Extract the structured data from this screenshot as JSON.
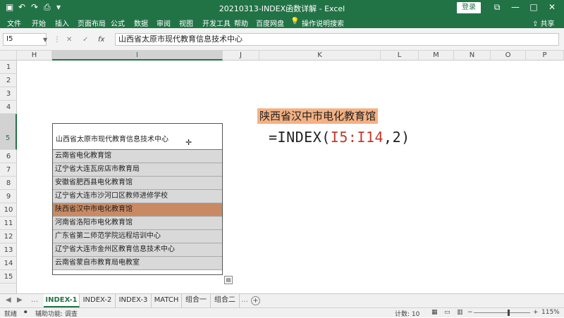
{
  "window": {
    "title": "20210313-INDEX函数详解 - Excel",
    "login_label": "登录",
    "restore_glyph": "⧉",
    "minimize_glyph": "—",
    "maximize_glyph": "□",
    "close_glyph": "✕"
  },
  "quick_access": {
    "autosave_glyph": "▣",
    "undo_glyph": "↶",
    "redo_glyph": "↷",
    "print_glyph": "⎙",
    "more_glyph": "▾"
  },
  "ribbon_tabs": [
    "文件",
    "开始",
    "插入",
    "页面布局",
    "公式",
    "数据",
    "审阅",
    "视图",
    "开发工具",
    "帮助",
    "百度网盘",
    "操作说明搜索"
  ],
  "share_label": "共享",
  "lightbulb_glyph": "💡",
  "formula_bar": {
    "name_box": "I5",
    "cancel_glyph": "✕",
    "enter_glyph": "✓",
    "fx_glyph": "fx",
    "content": "山西省太原市现代教育信息技术中心"
  },
  "columns": [
    "H",
    "I",
    "J",
    "K",
    "L",
    "M",
    "N",
    "O",
    "P"
  ],
  "selected_column": "I",
  "rows": [
    "1",
    "2",
    "3",
    "4",
    "5",
    "6",
    "7",
    "8",
    "9",
    "10",
    "11",
    "12",
    "13",
    "14",
    "15"
  ],
  "selected_row": "5",
  "table": {
    "header": "山西省太原市现代教育信息技术中心",
    "items": [
      "云南省电化教育馆",
      "辽宁省大连瓦房店市教育局",
      "安徽省肥西县电化教育馆",
      "辽宁省大连市沙河口区教师进修学校",
      "陕西省汉中市电化教育馆",
      "河南省洛阳市电化教育馆",
      "广东省第二师范学院远程培训中心",
      "辽宁省大连市金州区教育信息技术中心",
      "云南省蒙自市教育局电教室"
    ],
    "highlight_index": 4
  },
  "result_text": "陕西省汉中市电化教育馆",
  "formula_display": {
    "prefix": "=INDEX(",
    "ref": "I5:I14",
    "suffix": ",2)"
  },
  "sheet_tabs": [
    "INDEX-1",
    "INDEX-2",
    "INDEX-3",
    "MATCH",
    "组合一",
    "组合二"
  ],
  "active_sheet": "INDEX-1",
  "add_sheet_glyph": "+",
  "status": {
    "ready": "就绪",
    "accessibility": "辅助功能: 调查",
    "count": "计数: 10",
    "zoom": "115%",
    "zoom_minus": "−",
    "zoom_plus": "+"
  },
  "colors": {
    "accent": "#217346",
    "highlight_row": "#c98a63",
    "result_fill": "#f4b183",
    "ref_red": "#c0392b"
  }
}
